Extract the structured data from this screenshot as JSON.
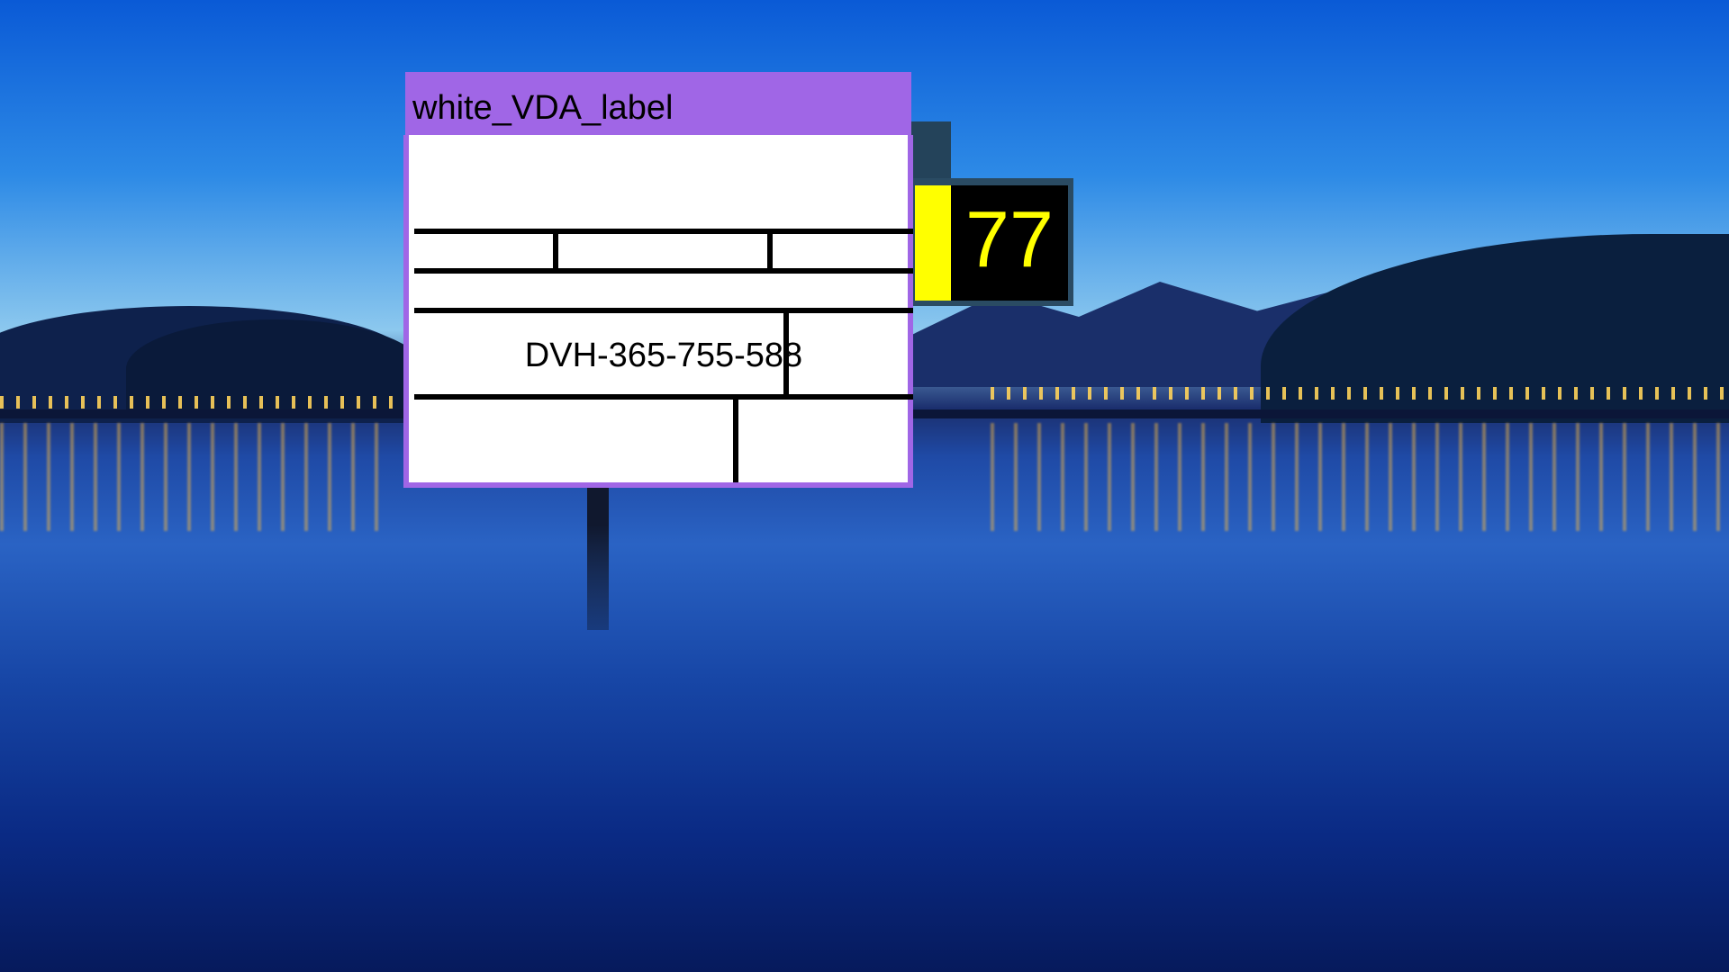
{
  "label_window": {
    "title": "white_VDA_label",
    "code": "DVH-365-755-588",
    "colors": {
      "titlebar": "#a066e6",
      "body": "#ffffff",
      "lines": "#000000"
    }
  },
  "counter": {
    "value": "77",
    "colors": {
      "indicator": "#ffff00",
      "display_bg": "#000000",
      "text": "#ffff00",
      "frame": "#2a4b63"
    }
  },
  "wallpaper": {
    "description_icon": "lake-night-wallpaper"
  }
}
